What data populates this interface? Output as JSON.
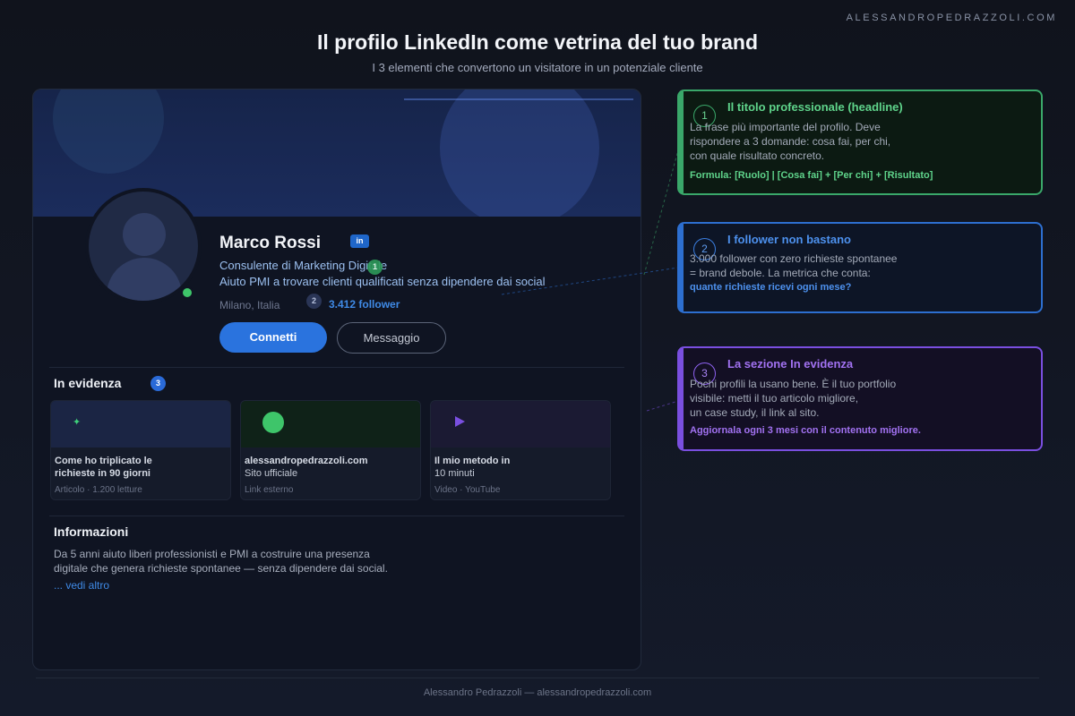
{
  "brand": "ALESSANDROPEDRAZZOLI.COM",
  "title": "Il profilo LinkedIn come vetrina del tuo brand",
  "subtitle": "I 3 elementi che convertono un visitatore in un potenziale cliente",
  "profile": {
    "name": "Marco Rossi",
    "badge": "in",
    "role": "Consulente di Marketing Digitale",
    "headline": "Aiuto PMI a trovare clienti qualificati senza dipendere dai social",
    "location": "Milano, Italia",
    "followers": "3.412 follower",
    "connect_label": "Connetti",
    "message_label": "Messaggio"
  },
  "markers": [
    "1",
    "2",
    "3"
  ],
  "featured": {
    "title": "In evidenza",
    "cards": [
      {
        "line1": "Come ho triplicato le",
        "line2": "richieste in 90 giorni",
        "meta": "Articolo · 1.200 letture",
        "icon": "sparkle-icon"
      },
      {
        "line1": "alessandropedrazzoli.com",
        "line2": "Sito ufficiale",
        "meta": "Link esterno",
        "icon": "globe-icon"
      },
      {
        "line1": "Il mio metodo in",
        "line2": "10 minuti",
        "meta": "Video · YouTube",
        "icon": "play-icon"
      }
    ]
  },
  "info": {
    "title": "Informazioni",
    "line1": "Da 5 anni aiuto liberi professionisti e PMI a costruire una presenza",
    "line2": "digitale che genera richieste spontanee — senza dipendere dai social.",
    "more": "... vedi altro"
  },
  "callouts": [
    {
      "num": "1",
      "title": "Il titolo professionale (headline)",
      "lines": [
        "La frase più importante del profilo. Deve",
        "rispondere a 3 domande: cosa fai, per chi,",
        "con quale risultato concreto."
      ],
      "strong": "Formula: [Ruolo] | [Cosa fai] + [Per chi] + [Risultato]",
      "color": "#3aa86a"
    },
    {
      "num": "2",
      "title": "I follower non bastano",
      "lines": [
        "3.000 follower con zero richieste spontanee",
        "= brand debole. La metrica che conta:"
      ],
      "strong": "quante richieste ricevi ogni mese?",
      "color": "#2d6fd0"
    },
    {
      "num": "3",
      "title": "La sezione In evidenza",
      "lines": [
        "Pochi profili la usano bene. È il tuo portfolio",
        "visibile: metti il tuo articolo migliore,",
        "un case study, il link al sito."
      ],
      "strong": "Aggiornala ogni 3 mesi con il contenuto migliore.",
      "color": "#7a4fe0"
    }
  ],
  "footer": "Alessandro Pedrazzoli — alessandropedrazzoli.com"
}
